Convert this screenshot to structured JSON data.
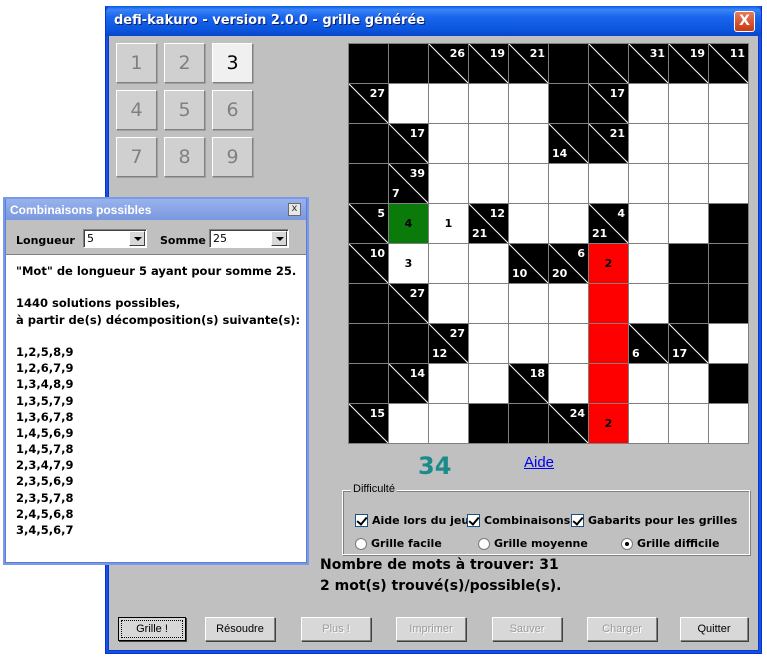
{
  "main_window": {
    "title": "defi-kakuro - version 2.0.0 - grille générée",
    "close_label": "X"
  },
  "number_pad": [
    "1",
    "2",
    "3",
    "4",
    "5",
    "6",
    "7",
    "8",
    "9"
  ],
  "number_pad_active": "3",
  "grid": [
    [
      {
        "t": "b"
      },
      {
        "t": "b"
      },
      {
        "t": "c",
        "a": "26"
      },
      {
        "t": "c",
        "a": "19"
      },
      {
        "t": "c",
        "a": "21"
      },
      {
        "t": "b"
      },
      {
        "t": "c"
      },
      {
        "t": "c",
        "a": "31"
      },
      {
        "t": "c",
        "a": "19"
      },
      {
        "t": "c",
        "a": "11"
      }
    ],
    [
      {
        "t": "c",
        "a": "27"
      },
      {
        "t": "w"
      },
      {
        "t": "w"
      },
      {
        "t": "w"
      },
      {
        "t": "w"
      },
      {
        "t": "b"
      },
      {
        "t": "c",
        "a": "17"
      },
      {
        "t": "w"
      },
      {
        "t": "w"
      },
      {
        "t": "w"
      }
    ],
    [
      {
        "t": "b"
      },
      {
        "t": "c",
        "a": "17"
      },
      {
        "t": "w"
      },
      {
        "t": "w"
      },
      {
        "t": "w"
      },
      {
        "t": "c",
        "d": "14"
      },
      {
        "t": "c",
        "a": "21"
      },
      {
        "t": "w"
      },
      {
        "t": "w"
      },
      {
        "t": "w"
      }
    ],
    [
      {
        "t": "b"
      },
      {
        "t": "c",
        "a": "39",
        "d": "7"
      },
      {
        "t": "w"
      },
      {
        "t": "w"
      },
      {
        "t": "w"
      },
      {
        "t": "w"
      },
      {
        "t": "w"
      },
      {
        "t": "w"
      },
      {
        "t": "w"
      },
      {
        "t": "w"
      }
    ],
    [
      {
        "t": "c",
        "a": "5"
      },
      {
        "t": "g",
        "v": "4"
      },
      {
        "t": "w",
        "v": "1"
      },
      {
        "t": "c",
        "a": "12",
        "d": "21"
      },
      {
        "t": "w"
      },
      {
        "t": "w"
      },
      {
        "t": "c",
        "a": "4",
        "d": "21"
      },
      {
        "t": "w"
      },
      {
        "t": "w"
      },
      {
        "t": "b"
      }
    ],
    [
      {
        "t": "c",
        "a": "10"
      },
      {
        "t": "w",
        "v": "3"
      },
      {
        "t": "w"
      },
      {
        "t": "w"
      },
      {
        "t": "c",
        "d": "10"
      },
      {
        "t": "c",
        "a": "6",
        "d": "20"
      },
      {
        "t": "r",
        "v": "2"
      },
      {
        "t": "w"
      },
      {
        "t": "b"
      },
      {
        "t": "b"
      }
    ],
    [
      {
        "t": "b"
      },
      {
        "t": "c",
        "a": "27"
      },
      {
        "t": "w"
      },
      {
        "t": "w"
      },
      {
        "t": "w"
      },
      {
        "t": "w"
      },
      {
        "t": "r"
      },
      {
        "t": "w"
      },
      {
        "t": "b"
      },
      {
        "t": "b"
      }
    ],
    [
      {
        "t": "b"
      },
      {
        "t": "b"
      },
      {
        "t": "c",
        "a": "27",
        "d": "12"
      },
      {
        "t": "w"
      },
      {
        "t": "w"
      },
      {
        "t": "w"
      },
      {
        "t": "r"
      },
      {
        "t": "c",
        "d": "6"
      },
      {
        "t": "c",
        "d": "17"
      },
      {
        "t": "w"
      }
    ],
    [
      {
        "t": "b"
      },
      {
        "t": "c",
        "a": "14"
      },
      {
        "t": "w"
      },
      {
        "t": "w"
      },
      {
        "t": "c",
        "a": "18"
      },
      {
        "t": "w"
      },
      {
        "t": "r"
      },
      {
        "t": "w"
      },
      {
        "t": "w"
      },
      {
        "t": "b"
      }
    ],
    [
      {
        "t": "c",
        "a": "15"
      },
      {
        "t": "w"
      },
      {
        "t": "w"
      },
      {
        "t": "b"
      },
      {
        "t": "b"
      },
      {
        "t": "c",
        "a": "24"
      },
      {
        "t": "r",
        "v": "2"
      },
      {
        "t": "w"
      },
      {
        "t": "w"
      },
      {
        "t": "w"
      }
    ]
  ],
  "score": "34",
  "help_link": "Aide",
  "difficulty": {
    "legend": "Difficulté",
    "checkboxes": [
      {
        "label": "Aide lors du jeu",
        "checked": true
      },
      {
        "label": "Combinaisons",
        "checked": true
      },
      {
        "label": "Gabarits pour les grilles",
        "checked": true
      }
    ],
    "radios": [
      {
        "label": "Grille facile",
        "selected": false
      },
      {
        "label": "Grille moyenne",
        "selected": false
      },
      {
        "label": "Grille difficile",
        "selected": true
      }
    ]
  },
  "status": {
    "words_to_find": "Nombre de mots à trouver: 31",
    "words_found": "2 mot(s) trouvé(s)/possible(s)."
  },
  "buttons": {
    "grille": "Grille !",
    "resoudre": "Résoudre",
    "plus": "Plus !",
    "imprimer": "Imprimer",
    "sauver": "Sauver",
    "charger": "Charger",
    "quitter": "Quitter"
  },
  "combo_window": {
    "title": "Combinaisons possibles",
    "close_label": "x",
    "length_label": "Longueur",
    "length_value": "5",
    "sum_label": "Somme",
    "sum_value": "25",
    "lines": [
      "\"Mot\" de longueur 5 ayant pour somme 25.",
      "",
      "1440 solutions possibles,",
      "à partir de(s) décomposition(s) suivante(s):",
      "",
      "1,2,5,8,9",
      "1,2,6,7,9",
      "1,3,4,8,9",
      "1,3,5,7,9",
      "1,3,6,7,8",
      "1,4,5,6,9",
      "1,4,5,7,8",
      "2,3,4,7,9",
      "2,3,5,6,9",
      "2,3,5,7,8",
      "2,4,5,6,8",
      "3,4,5,6,7"
    ]
  }
}
